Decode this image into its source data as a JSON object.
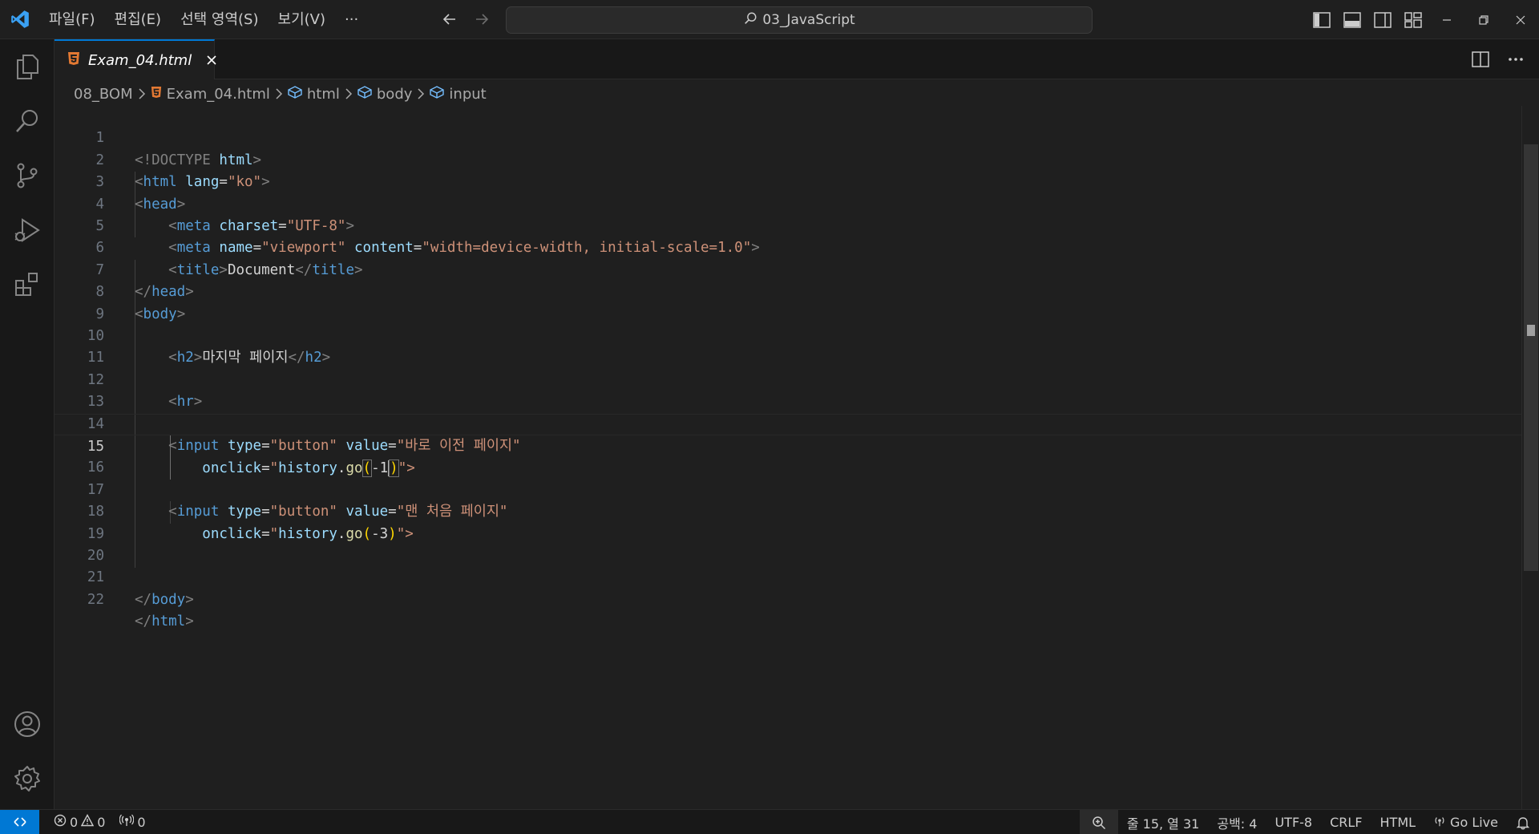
{
  "titlebar": {
    "menu": [
      "파일(F)",
      "편집(E)",
      "선택 영역(S)",
      "보기(V)",
      "···"
    ],
    "search_text": "03_JavaScript"
  },
  "tab": {
    "label": "Exam_04.html"
  },
  "breadcrumb": {
    "folder": "08_BOM",
    "file": "Exam_04.html",
    "html": "html",
    "body": "body",
    "input": "input"
  },
  "editor": {
    "active_line": 15,
    "lines": [
      {
        "n": "1"
      },
      {
        "n": "2"
      },
      {
        "n": "3"
      },
      {
        "n": "4"
      },
      {
        "n": "5"
      },
      {
        "n": "6"
      },
      {
        "n": "7"
      },
      {
        "n": "8"
      },
      {
        "n": "9"
      },
      {
        "n": "10"
      },
      {
        "n": "11"
      },
      {
        "n": "12"
      },
      {
        "n": "13"
      },
      {
        "n": "14"
      },
      {
        "n": "15"
      },
      {
        "n": "16"
      },
      {
        "n": "17"
      },
      {
        "n": "18"
      },
      {
        "n": "19"
      },
      {
        "n": "20"
      },
      {
        "n": "21"
      },
      {
        "n": "22"
      }
    ],
    "tokens": {
      "doctype": "<!DOCTYPE",
      "html": "html",
      "lt": "<",
      "gt": ">",
      "lt_slash": "</",
      "eq": "=",
      "lang": "lang",
      "ko": "\"ko\"",
      "head": "head",
      "meta": "meta",
      "charset": "charset",
      "utf8": "\"UTF-8\"",
      "name": "name",
      "viewport": "\"viewport\"",
      "content": "content",
      "content_val": "\"width=device-width, initial-scale=1.0\"",
      "title": "title",
      "document": "Document",
      "body": "body",
      "h2": "h2",
      "h2_text": "마지막 페이지",
      "hr": "hr",
      "input": "input",
      "type": "type",
      "button": "\"button\"",
      "value": "value",
      "value1": "\"바로 이전 페이지\"",
      "value2": "\"맨 처음 페이지\"",
      "onclick": "onclick",
      "q": "\"",
      "history": "history",
      "dot": ".",
      "go": "go",
      "lparen": "(",
      "rparen": ")",
      "neg1": "-1",
      "neg3": "-3",
      "qgt": "\">"
    }
  },
  "statusbar": {
    "errors": "0",
    "warnings": "0",
    "ports": "0",
    "cursor_pos": "줄 15, 열 31",
    "spaces": "공백: 4",
    "encoding": "UTF-8",
    "eol": "CRLF",
    "language": "HTML",
    "golive": "Go Live"
  },
  "colors": {
    "accent": "#0078d4",
    "html_icon": "#e37933",
    "bracket": "#ffd700"
  }
}
